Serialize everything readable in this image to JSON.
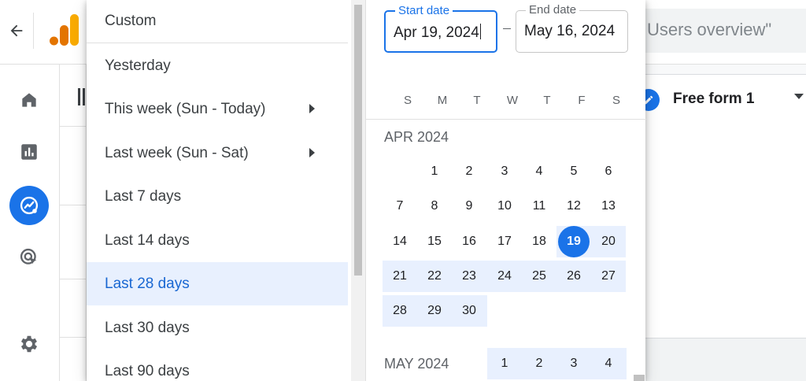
{
  "app": {
    "search_text": "Users overview\"",
    "card_title": "Free form 1"
  },
  "nav": {
    "items": [
      "home-icon",
      "reports-icon",
      "explore-icon",
      "advertising-icon",
      "settings-icon"
    ],
    "active": "explore-icon"
  },
  "presets": [
    {
      "label": "Custom",
      "has_submenu": false,
      "selected": false
    },
    {
      "label": "Yesterday",
      "has_submenu": false,
      "selected": false
    },
    {
      "label": "This week (Sun - Today)",
      "has_submenu": true,
      "selected": false
    },
    {
      "label": "Last week (Sun - Sat)",
      "has_submenu": true,
      "selected": false
    },
    {
      "label": "Last 7 days",
      "has_submenu": false,
      "selected": false
    },
    {
      "label": "Last 14 days",
      "has_submenu": false,
      "selected": false
    },
    {
      "label": "Last 28 days",
      "has_submenu": false,
      "selected": true
    },
    {
      "label": "Last 30 days",
      "has_submenu": false,
      "selected": false
    },
    {
      "label": "Last 90 days",
      "has_submenu": false,
      "selected": false
    }
  ],
  "date_range": {
    "start_label": "Start date",
    "start_value": "Apr 19, 2024",
    "end_label": "End date",
    "end_value": "May 16, 2024"
  },
  "calendar": {
    "weekdays": [
      "S",
      "M",
      "T",
      "W",
      "T",
      "F",
      "S"
    ],
    "selected_start_day": 19,
    "months": [
      {
        "label": "APR 2024",
        "first_weekday": 1,
        "days_in_month": 30,
        "range_start_day": 19,
        "range_end_day": 30
      },
      {
        "label": "MAY 2024",
        "first_weekday": 3,
        "visible_days": [
          1,
          2,
          3,
          4
        ],
        "range_start_day": 1
      }
    ]
  },
  "colors": {
    "accent": "#1a73e8",
    "range_highlight": "#e8f0fe",
    "selected_text": "#1967d2"
  }
}
